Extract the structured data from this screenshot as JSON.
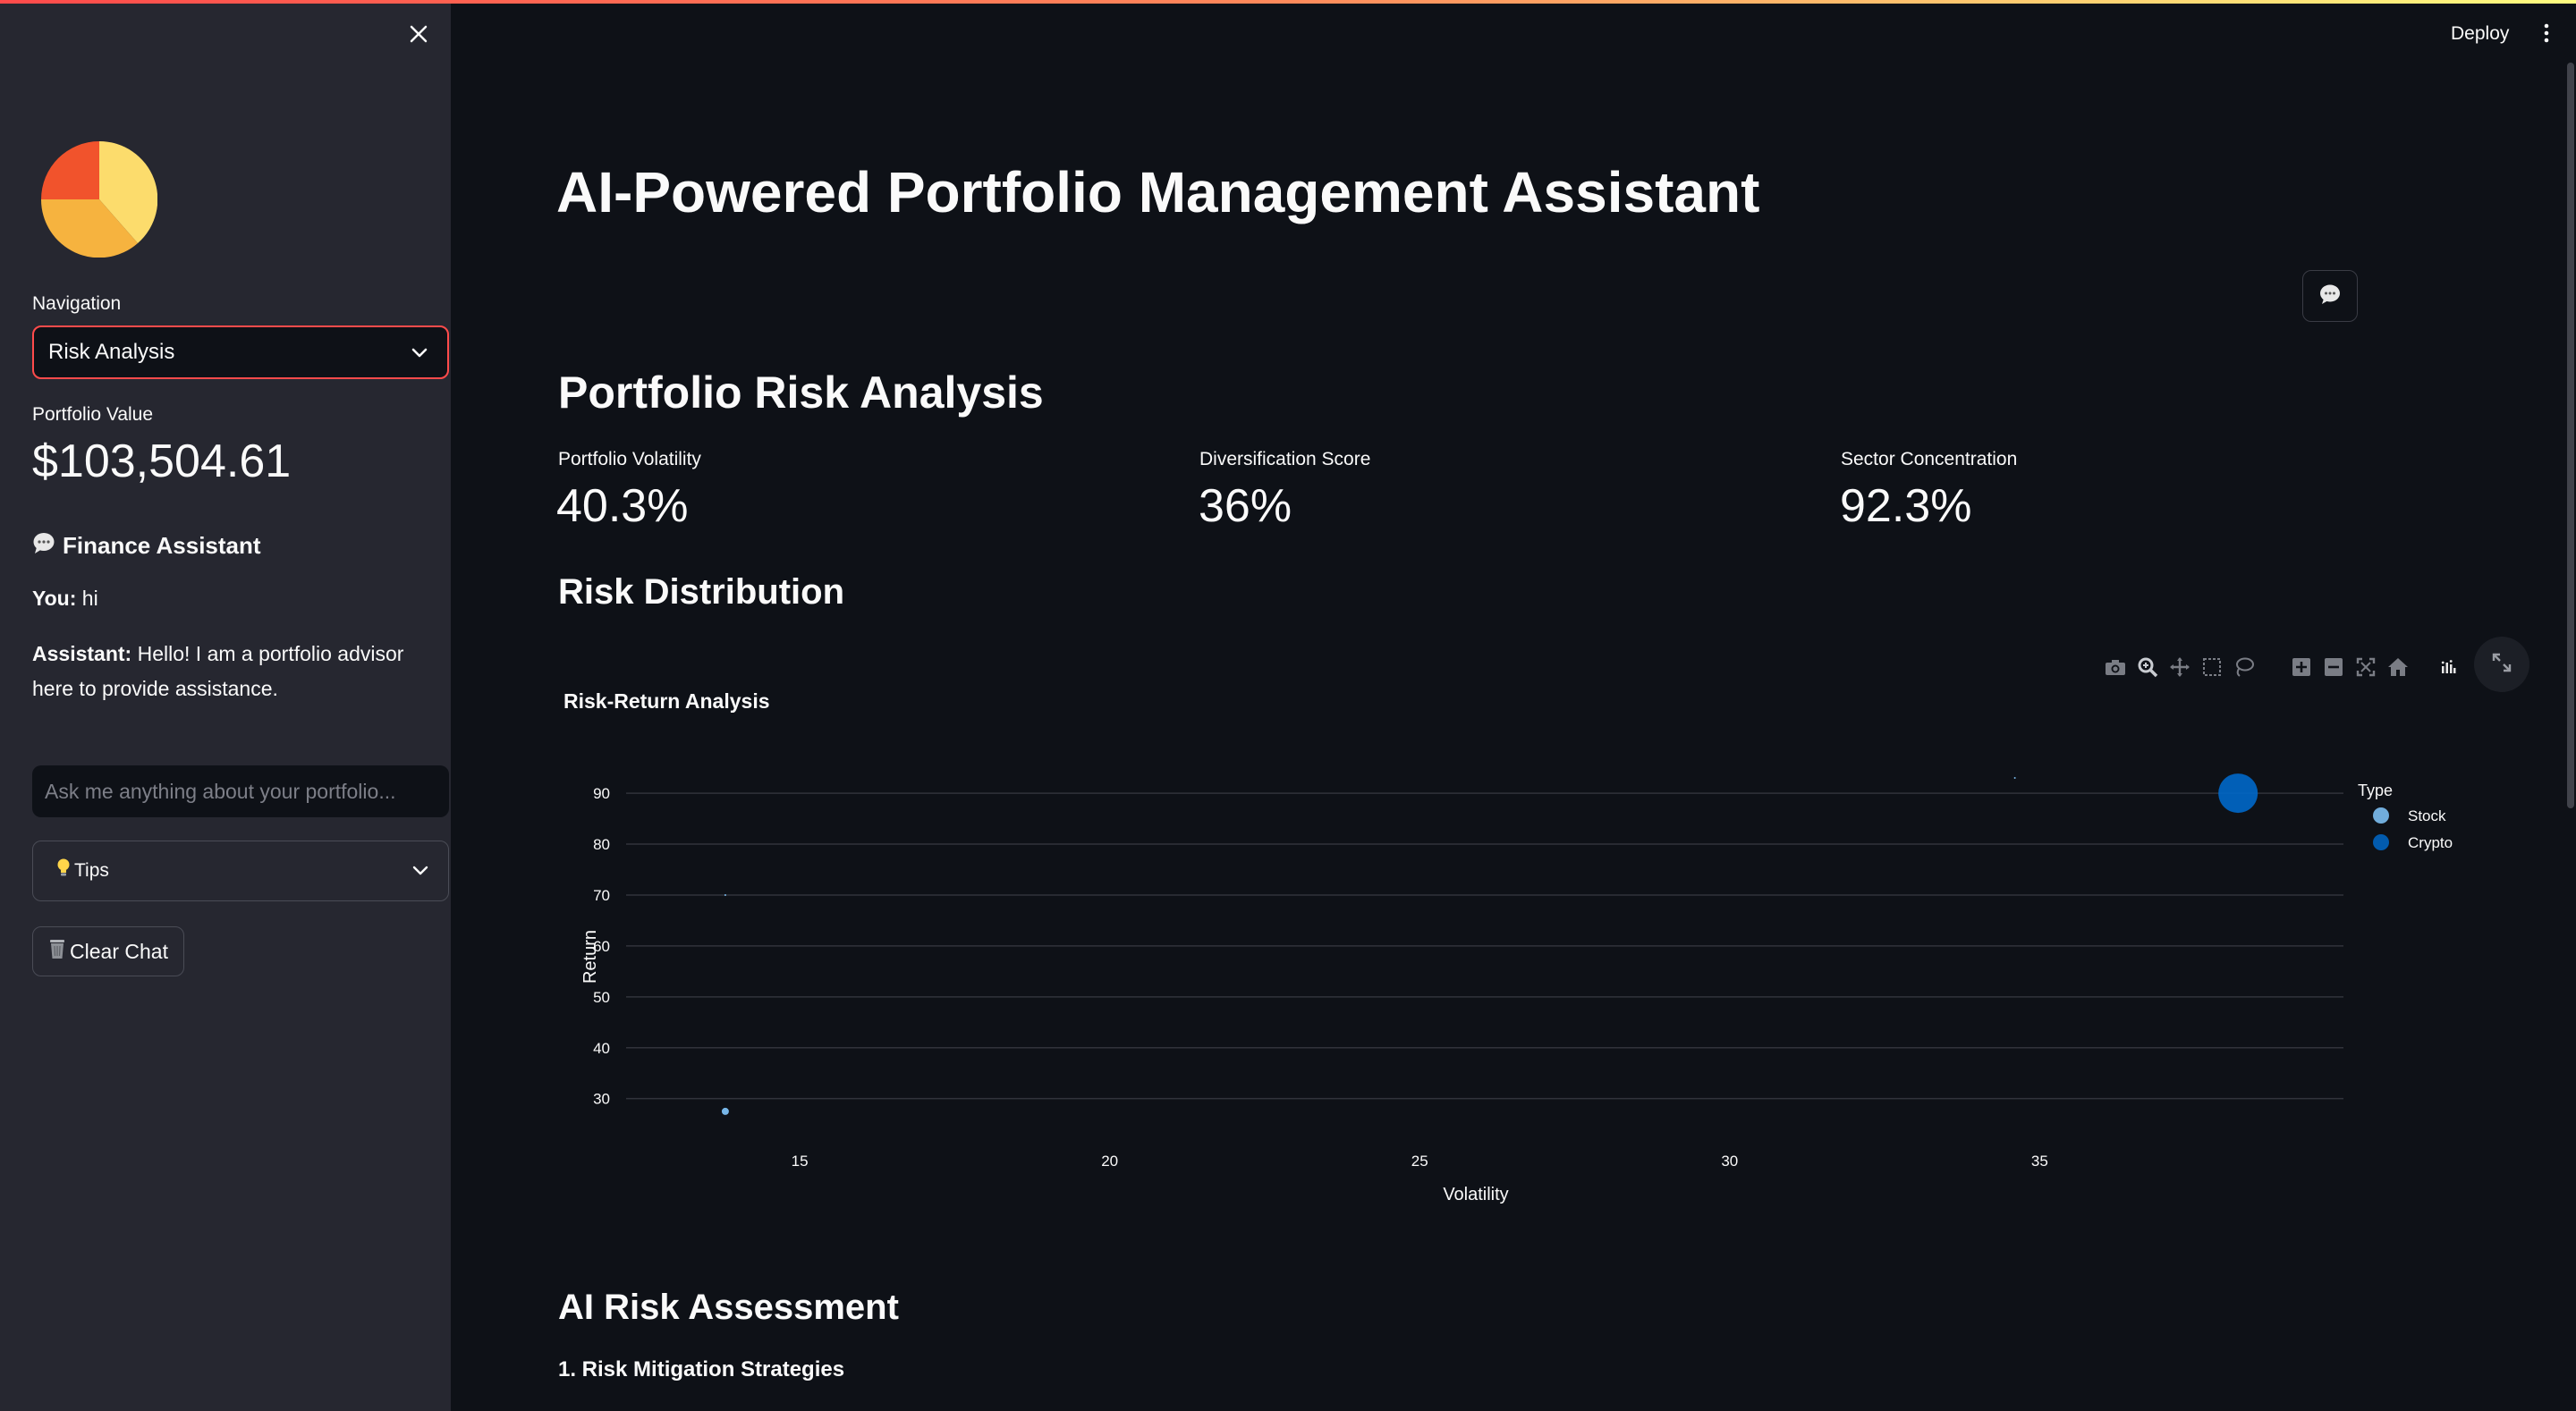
{
  "sidebar": {
    "nav_label": "Navigation",
    "nav_selected": "Risk Analysis",
    "portfolio_value_label": "Portfolio Value",
    "portfolio_value": "$103,504.61",
    "assistant_title": "Finance Assistant",
    "assistant_icon": "speech-bubble-icon",
    "messages": [
      {
        "speaker": "You:",
        "text": "hi"
      },
      {
        "speaker": "Assistant:",
        "text": "Hello! I am a portfolio advisor here to provide assistance."
      }
    ],
    "chat_placeholder": "Ask me anything about your portfolio...",
    "tips_label": "Tips",
    "tips_icon": "lightbulb-icon",
    "clear_label": "Clear Chat",
    "clear_icon": "trash-icon"
  },
  "header": {
    "deploy_label": "Deploy"
  },
  "main": {
    "title": "AI-Powered Portfolio Management Assistant",
    "risk_heading": "Portfolio Risk Analysis",
    "metrics": [
      {
        "label": "Portfolio Volatility",
        "value": "40.3%"
      },
      {
        "label": "Diversification Score",
        "value": "36%"
      },
      {
        "label": "Sector Concentration",
        "value": "92.3%"
      }
    ],
    "distribution_heading": "Risk Distribution",
    "ai_heading": "AI Risk Assessment",
    "mitigation_item": "1. Risk Mitigation Strategies"
  },
  "colors": {
    "accent": "#ff4b4b",
    "stock": "#83c9ff",
    "crypto": "#0068c9",
    "logo_red": "#f1532c",
    "logo_orange": "#f6b33f",
    "logo_yellow": "#fcdc6c"
  },
  "chart_data": {
    "type": "scatter",
    "title": "Risk-Return Analysis",
    "xlabel": "Volatility",
    "ylabel": "Return",
    "xlim": [
      12.2,
      39.9
    ],
    "ylim": [
      24.5,
      93
    ],
    "x_ticks": [
      15,
      20,
      25,
      30,
      35
    ],
    "y_ticks": [
      30,
      40,
      50,
      60,
      70,
      80,
      90
    ],
    "grid": true,
    "legend_title": "Type",
    "legend_position": "top-right",
    "series": [
      {
        "name": "Stock",
        "color": "#83c9ff",
        "points": [
          {
            "x": 13.8,
            "y": 27.5,
            "size": 4
          },
          {
            "x": 13.8,
            "y": 70,
            "size": 1
          },
          {
            "x": 34.6,
            "y": 93,
            "size": 1
          }
        ]
      },
      {
        "name": "Crypto",
        "color": "#0068c9",
        "points": [
          {
            "x": 38.2,
            "y": 90,
            "size": 22
          }
        ]
      }
    ]
  }
}
